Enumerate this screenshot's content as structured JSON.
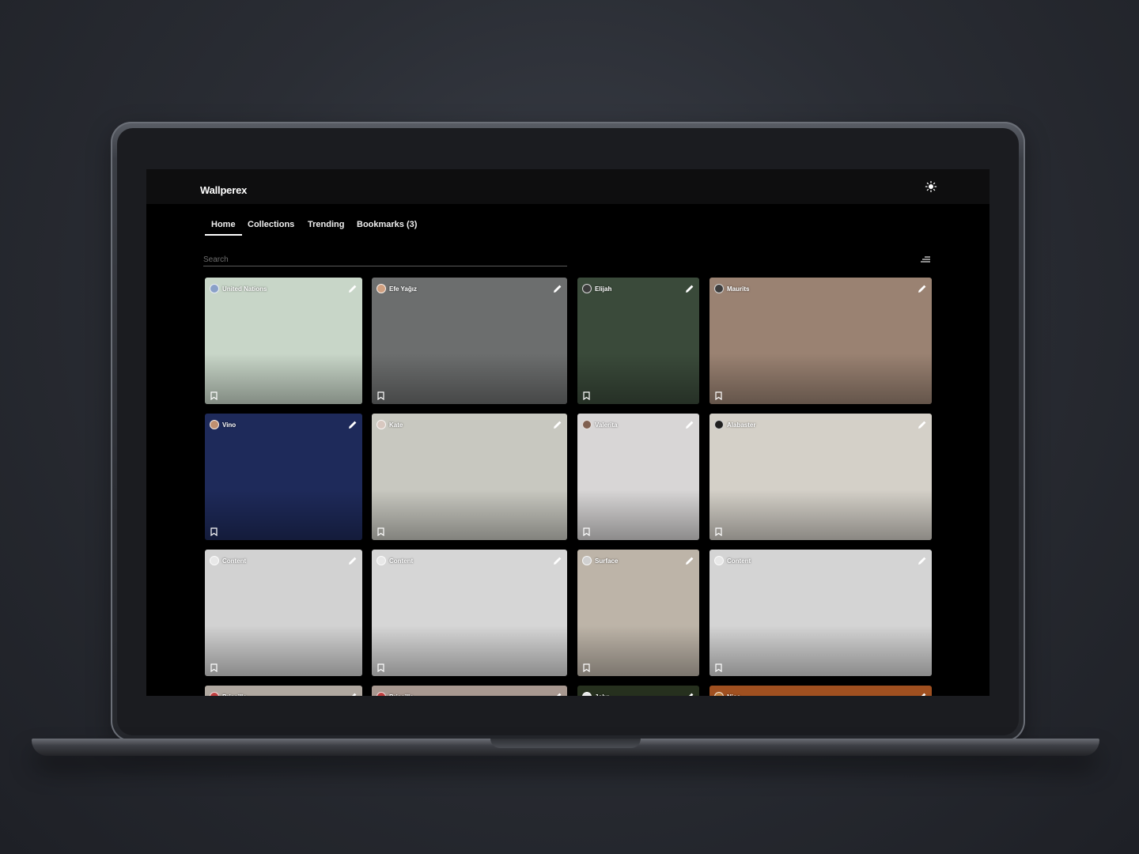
{
  "app": {
    "brand": "Wallperex"
  },
  "icons": {
    "theme": "sun-icon",
    "filter": "sort-lines-icon",
    "edit": "pencil-icon",
    "bookmark": "bookmark-icon"
  },
  "nav": {
    "tabs": [
      {
        "label": "Home",
        "active": true
      },
      {
        "label": "Collections",
        "active": false
      },
      {
        "label": "Trending",
        "active": false
      },
      {
        "label": "Bookmarks (3)",
        "active": false
      }
    ]
  },
  "search": {
    "placeholder": "Search",
    "value": ""
  },
  "colors": {
    "background": "#000000",
    "topbar": "#0e0e0f",
    "text": "#ffffff",
    "accent_underline": "#ffffff"
  },
  "grid": {
    "cards": [
      {
        "author": "United Nations",
        "avatar_color": "#8aa0c8",
        "bg": "#c8d6c8"
      },
      {
        "author": "Efe Yağız",
        "avatar_color": "#d0a080",
        "bg": "#6c6e6e"
      },
      {
        "author": "Elijah",
        "avatar_color": "#3c3c3c",
        "bg": "#3a4a3a"
      },
      {
        "author": "Maurits",
        "avatar_color": "#3c3c3c",
        "bg": "#9a8272"
      },
      {
        "author": "Vino",
        "avatar_color": "#c09070",
        "bg": "#1e2a5a"
      },
      {
        "author": "Kate",
        "avatar_color": "#d8c8c0",
        "bg": "#c8c8c0"
      },
      {
        "author": "Valerita",
        "avatar_color": "#806050",
        "bg": "#d8d6d6"
      },
      {
        "author": "Alabaster",
        "avatar_color": "#202020",
        "bg": "#d4d0c8"
      },
      {
        "author": "Content",
        "avatar_color": "#e8e8e8",
        "bg": "#d2d2d2"
      },
      {
        "author": "Content",
        "avatar_color": "#e8e8e8",
        "bg": "#d6d6d6"
      },
      {
        "author": "Surface",
        "avatar_color": "#d0d0d0",
        "bg": "#bdb4a8"
      },
      {
        "author": "Content",
        "avatar_color": "#e8e8e8",
        "bg": "#d4d4d4"
      },
      {
        "author": "Priscilla",
        "avatar_color": "#c04040",
        "bg": "#b0a8a0"
      },
      {
        "author": "Priscilla",
        "avatar_color": "#c04040",
        "bg": "#a89890"
      },
      {
        "author": "John",
        "avatar_color": "#e8e8e8",
        "bg": "#26301e"
      },
      {
        "author": "Nico",
        "avatar_color": "#c08040",
        "bg": "#a05020"
      }
    ]
  }
}
